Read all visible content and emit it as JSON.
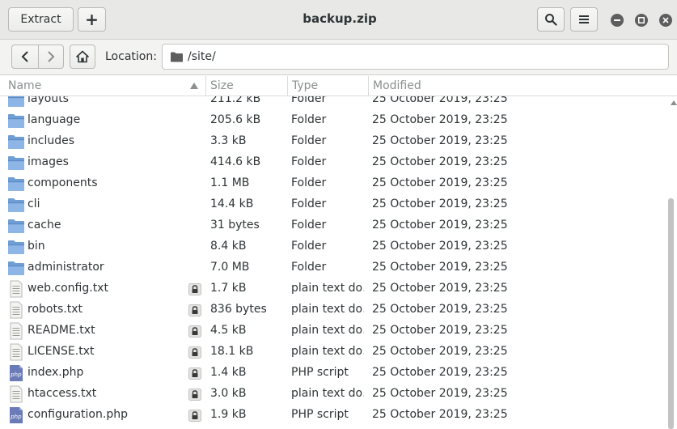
{
  "header": {
    "title": "backup.zip",
    "extract_label": "Extract",
    "add_label": "+",
    "search_icon": "search-icon",
    "menu_icon": "hamburger-icon"
  },
  "location": {
    "label": "Location:",
    "path": "/site/"
  },
  "columns": {
    "name": "Name",
    "size": "Size",
    "type": "Type",
    "modified": "Modified"
  },
  "files": [
    {
      "name": "layouts",
      "size": "211.2 kB",
      "type": "Folder",
      "modified": "25 October 2019, 23:25",
      "kind": "folder"
    },
    {
      "name": "language",
      "size": "205.6 kB",
      "type": "Folder",
      "modified": "25 October 2019, 23:25",
      "kind": "folder"
    },
    {
      "name": "includes",
      "size": "3.3 kB",
      "type": "Folder",
      "modified": "25 October 2019, 23:25",
      "kind": "folder"
    },
    {
      "name": "images",
      "size": "414.6 kB",
      "type": "Folder",
      "modified": "25 October 2019, 23:25",
      "kind": "folder"
    },
    {
      "name": "components",
      "size": "1.1 MB",
      "type": "Folder",
      "modified": "25 October 2019, 23:25",
      "kind": "folder"
    },
    {
      "name": "cli",
      "size": "14.4 kB",
      "type": "Folder",
      "modified": "25 October 2019, 23:25",
      "kind": "folder"
    },
    {
      "name": "cache",
      "size": "31 bytes",
      "type": "Folder",
      "modified": "25 October 2019, 23:25",
      "kind": "folder"
    },
    {
      "name": "bin",
      "size": "8.4 kB",
      "type": "Folder",
      "modified": "25 October 2019, 23:25",
      "kind": "folder"
    },
    {
      "name": "administrator",
      "size": "7.0 MB",
      "type": "Folder",
      "modified": "25 October 2019, 23:25",
      "kind": "folder"
    },
    {
      "name": "web.config.txt",
      "size": "1.7 kB",
      "type": "plain text do…",
      "modified": "25 October 2019, 23:25",
      "kind": "text"
    },
    {
      "name": "robots.txt",
      "size": "836 bytes",
      "type": "plain text do…",
      "modified": "25 October 2019, 23:25",
      "kind": "text"
    },
    {
      "name": "README.txt",
      "size": "4.5 kB",
      "type": "plain text do…",
      "modified": "25 October 2019, 23:25",
      "kind": "text"
    },
    {
      "name": "LICENSE.txt",
      "size": "18.1 kB",
      "type": "plain text do…",
      "modified": "25 October 2019, 23:25",
      "kind": "text"
    },
    {
      "name": "index.php",
      "size": "1.4 kB",
      "type": "PHP script",
      "modified": "25 October 2019, 23:25",
      "kind": "php"
    },
    {
      "name": "htaccess.txt",
      "size": "3.0 kB",
      "type": "plain text do…",
      "modified": "25 October 2019, 23:25",
      "kind": "text"
    },
    {
      "name": "configuration.php",
      "size": "1.9 kB",
      "type": "PHP script",
      "modified": "25 October 2019, 23:25",
      "kind": "php"
    }
  ],
  "colors": {
    "folder": "#6f9ed5",
    "headerbar": "#e8e8e7",
    "php": "#6b7bb8"
  }
}
